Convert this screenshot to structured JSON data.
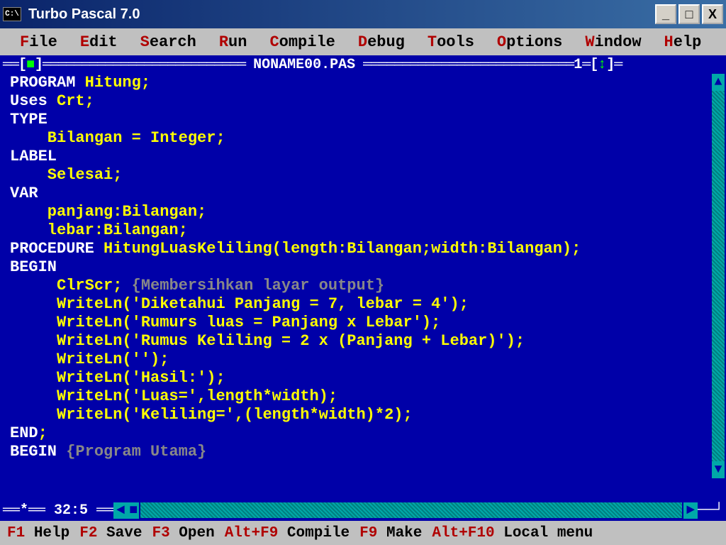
{
  "titlebar": {
    "icon_label": "C:\\",
    "title": "Turbo Pascal 7.0"
  },
  "win_controls": {
    "minimize": "_",
    "maximize": "□",
    "close": "X"
  },
  "menu": [
    {
      "hotkey": "F",
      "rest": "ile"
    },
    {
      "hotkey": "E",
      "rest": "dit"
    },
    {
      "hotkey": "S",
      "rest": "earch"
    },
    {
      "hotkey": "R",
      "rest": "un"
    },
    {
      "hotkey": "C",
      "rest": "ompile"
    },
    {
      "hotkey": "D",
      "rest": "ebug"
    },
    {
      "hotkey": "T",
      "rest": "ools"
    },
    {
      "hotkey": "O",
      "rest": "ptions"
    },
    {
      "hotkey": "W",
      "rest": "indow"
    },
    {
      "hotkey": "H",
      "rest": "elp"
    }
  ],
  "frame": {
    "filename": "NONAME00.PAS",
    "window_number": "1",
    "close_glyph": "■",
    "updown_glyph": "↕"
  },
  "code": [
    [
      {
        "c": "kw",
        "t": "PROGRAM "
      },
      {
        "c": "id",
        "t": "Hitung;"
      }
    ],
    [
      {
        "c": "kw",
        "t": "Uses "
      },
      {
        "c": "id",
        "t": "Crt;"
      }
    ],
    [
      {
        "c": "kw",
        "t": "TYPE"
      }
    ],
    [
      {
        "c": "id",
        "t": "    Bilangan = Integer;"
      }
    ],
    [
      {
        "c": "kw",
        "t": "LABEL"
      }
    ],
    [
      {
        "c": "id",
        "t": "    Selesai;"
      }
    ],
    [
      {
        "c": "kw",
        "t": "VAR"
      }
    ],
    [
      {
        "c": "id",
        "t": "    panjang:Bilangan;"
      }
    ],
    [
      {
        "c": "id",
        "t": "    lebar:Bilangan;"
      }
    ],
    [
      {
        "c": "kw",
        "t": "PROCEDURE "
      },
      {
        "c": "id",
        "t": "HitungLuasKeliling(length:Bilangan;width:Bilangan);"
      }
    ],
    [
      {
        "c": "kw",
        "t": "BEGIN"
      }
    ],
    [
      {
        "c": "id",
        "t": "     ClrScr; "
      },
      {
        "c": "cm",
        "t": "{Membersihkan layar output}"
      }
    ],
    [
      {
        "c": "id",
        "t": "     WriteLn('Diketahui Panjang = 7, lebar = 4');"
      }
    ],
    [
      {
        "c": "id",
        "t": "     WriteLn('Rumurs luas = Panjang x Lebar');"
      }
    ],
    [
      {
        "c": "id",
        "t": "     WriteLn('Rumus Keliling = 2 x (Panjang + Lebar)');"
      }
    ],
    [
      {
        "c": "id",
        "t": "     WriteLn('');"
      }
    ],
    [
      {
        "c": "id",
        "t": "     WriteLn('Hasil:');"
      }
    ],
    [
      {
        "c": "id",
        "t": "     WriteLn('Luas=',length*width);"
      }
    ],
    [
      {
        "c": "id",
        "t": "     WriteLn('Keliling=',(length*width)*2);"
      }
    ],
    [
      {
        "c": "kw",
        "t": "END"
      },
      {
        "c": "id",
        "t": ";"
      }
    ],
    [
      {
        "c": "kw",
        "t": "BEGIN "
      },
      {
        "c": "cm",
        "t": "{Program Utama}"
      }
    ]
  ],
  "status": {
    "modified_glyph": "*",
    "cursor_pos": "32:5"
  },
  "fnbar": [
    {
      "key": "F1",
      "label": " Help"
    },
    {
      "key": "F2",
      "label": " Save"
    },
    {
      "key": "F3",
      "label": " Open"
    },
    {
      "key": "Alt+F9",
      "label": " Compile"
    },
    {
      "key": "F9",
      "label": " Make"
    },
    {
      "key": "Alt+F10",
      "label": " Local menu"
    }
  ]
}
